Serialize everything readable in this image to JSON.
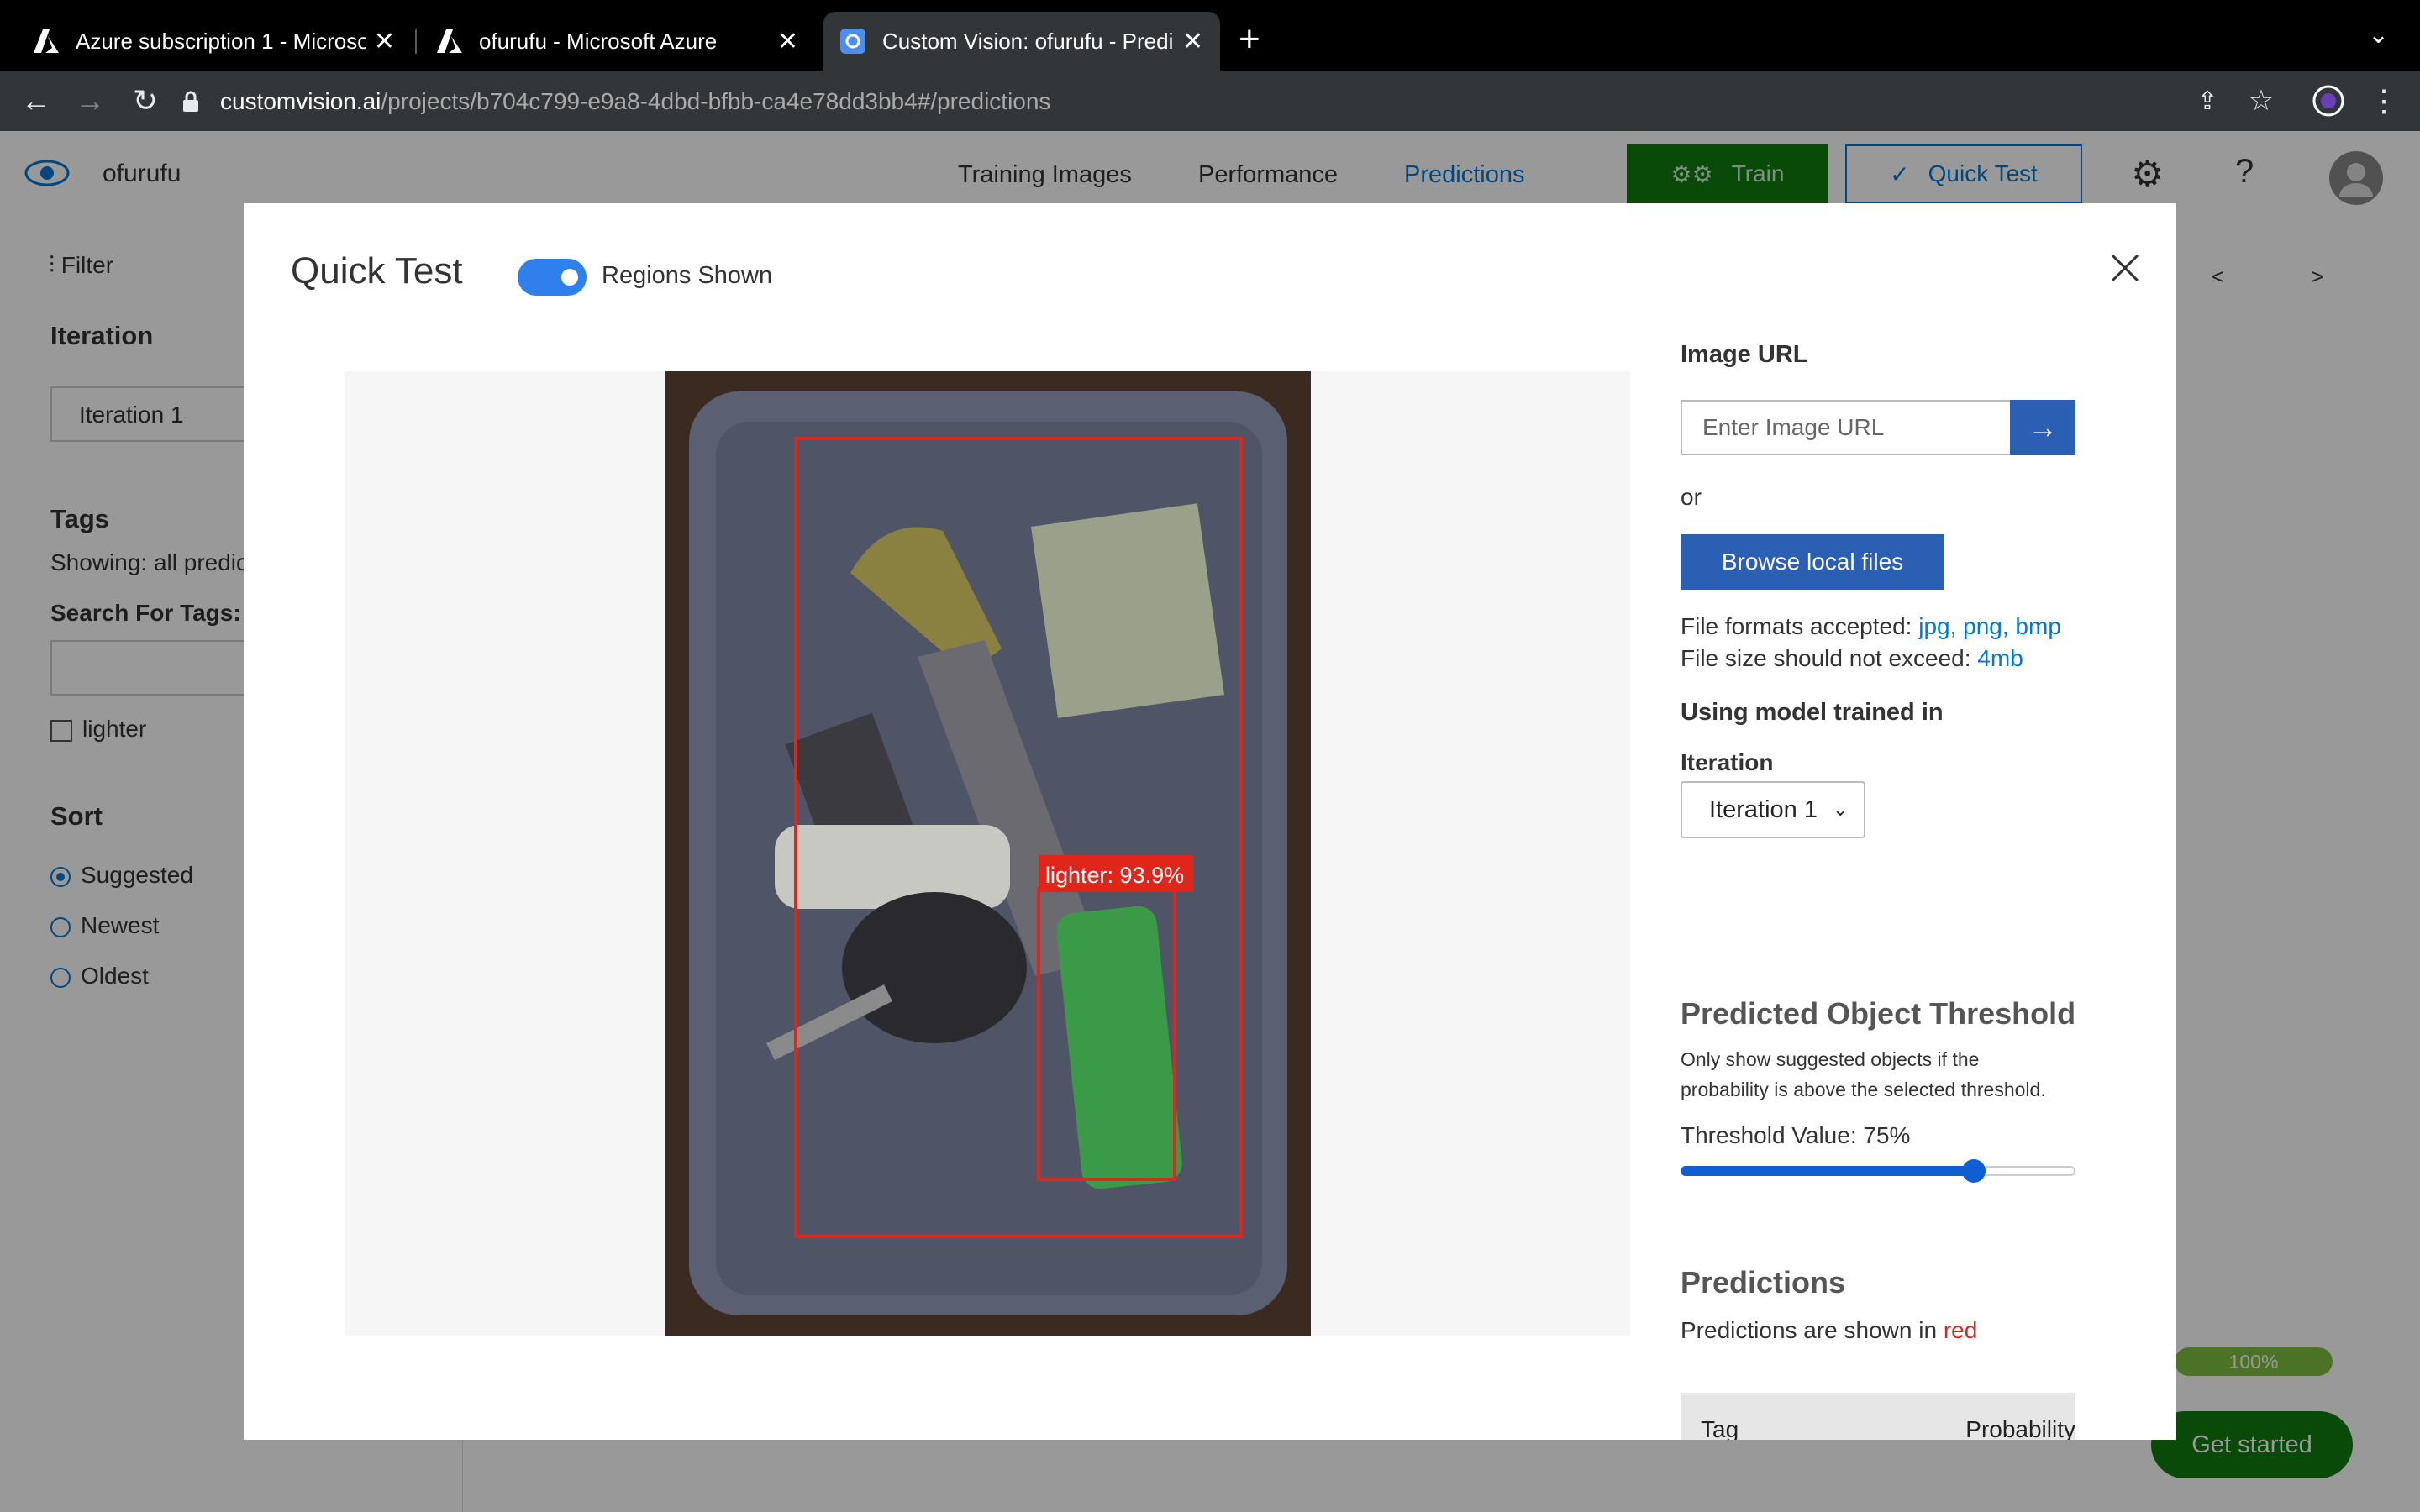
{
  "browser": {
    "tabs": [
      {
        "label": "Azure subscription 1 - Microso",
        "icon": "azure-logo-icon",
        "active": false
      },
      {
        "label": "ofurufu - Microsoft Azure",
        "icon": "azure-logo-icon",
        "active": false
      },
      {
        "label": "Custom Vision: ofurufu - Predic",
        "icon": "custom-vision-icon",
        "active": true
      }
    ],
    "new_tab": "+",
    "url_host": "customvision.ai",
    "url_path": "/projects/b704c799-e9a8-4dbd-bfbb-ca4e78dd3bb4#/predictions"
  },
  "app": {
    "project_name": "ofurufu",
    "nav": {
      "training_images": "Training Images",
      "performance": "Performance",
      "predictions": "Predictions"
    },
    "train_label": "Train",
    "quick_test_label": "Quick Test"
  },
  "sidebar": {
    "filter_label": "Filter",
    "iteration_heading": "Iteration",
    "iteration_value": "Iteration 1",
    "tags_heading": "Tags",
    "showing_text": "Showing: all predic",
    "search_label": "Search For Tags:",
    "tag_items": [
      "lighter"
    ],
    "sort_heading": "Sort",
    "sort_options": [
      {
        "label": "Suggested",
        "selected": true
      },
      {
        "label": "Newest",
        "selected": false
      },
      {
        "label": "Oldest",
        "selected": false
      }
    ]
  },
  "pager": {
    "prev": "<",
    "next": ">"
  },
  "background": {
    "progress_label": "100%",
    "progress": 1.0,
    "get_started": "Get started"
  },
  "modal": {
    "title": "Quick Test",
    "toggle_label": "Regions Shown",
    "toggle_on": true,
    "region_label": "lighter: 93.9%",
    "image_url_heading": "Image URL",
    "image_url_placeholder": "Enter Image URL",
    "or_text": "or",
    "browse_label": "Browse local files",
    "formats_prefix": "File formats accepted:",
    "formats": "jpg, png, bmp",
    "size_prefix": "File size should not exceed:",
    "size": "4mb",
    "model_heading": "Using model trained in",
    "iteration_label": "Iteration",
    "iteration_value": "Iteration 1",
    "threshold_heading": "Predicted Object Threshold",
    "threshold_desc_1": "Only show suggested objects if the",
    "threshold_desc_2": "probability is above the selected threshold.",
    "threshold_value_text": "Threshold Value: 75%",
    "threshold": 0.75,
    "predictions_heading": "Predictions",
    "predictions_desc_prefix": "Predictions are shown in",
    "predictions_desc_color": "red",
    "table_headers": [
      "Tag",
      "Probability"
    ]
  },
  "colors": {
    "accent": "#0078d4",
    "train": "#107c10",
    "region": "#e0261b",
    "button": "#2b5fb4"
  }
}
